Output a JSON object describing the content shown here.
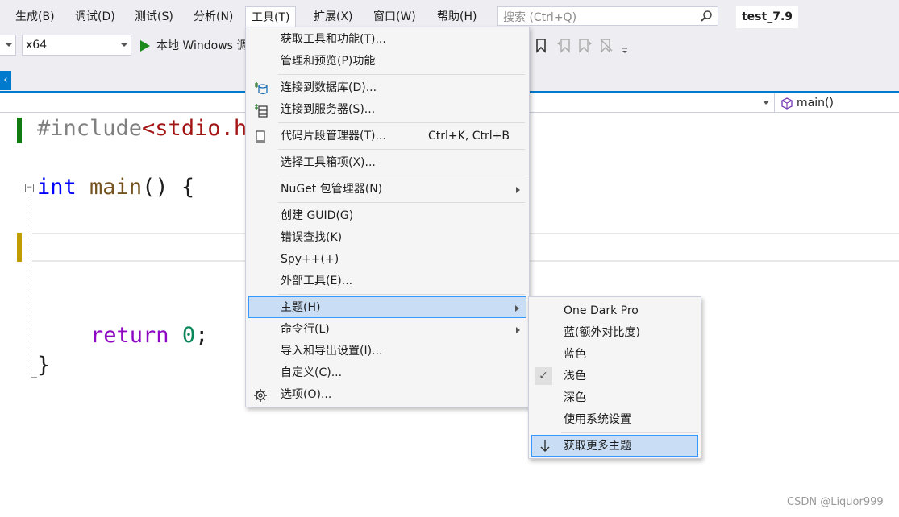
{
  "menubar": {
    "items": [
      "生成(B)",
      "调试(D)",
      "测试(S)",
      "分析(N)",
      "工具(T)",
      "扩展(X)",
      "窗口(W)",
      "帮助(H)"
    ],
    "search_placeholder": "搜索 (Ctrl+Q)",
    "project_title": "test_7.9"
  },
  "toolbar": {
    "platform": "x64",
    "run_label": "本地 Windows 调"
  },
  "navbar": {
    "function": "main()"
  },
  "editor": {
    "line_include_directive": "#include",
    "line_include_header": "<stdio.h",
    "line_main_type": "int",
    "line_main_name": "main",
    "line_main_rest": "() {",
    "line_return_kw": "return",
    "line_return_value": "0",
    "line_return_semicolon": ";",
    "line_close": "}"
  },
  "tools_menu": {
    "items": [
      {
        "label": "获取工具和功能(T)...",
        "icon": "none"
      },
      {
        "label": "管理和预览(P)功能",
        "icon": "none"
      },
      {
        "label": "连接到数据库(D)...",
        "icon": "database-connect-icon"
      },
      {
        "label": "连接到服务器(S)...",
        "icon": "server-connect-icon"
      },
      {
        "label": "代码片段管理器(T)...",
        "shortcut": "Ctrl+K, Ctrl+B",
        "icon": "snippet-icon"
      },
      {
        "label": "选择工具箱项(X)...",
        "icon": "none"
      },
      {
        "label": "NuGet 包管理器(N)",
        "submenu": true,
        "icon": "none"
      },
      {
        "label": "创建 GUID(G)",
        "icon": "none"
      },
      {
        "label": "错误查找(K)",
        "icon": "none"
      },
      {
        "label": "Spy++(+)",
        "icon": "none"
      },
      {
        "label": "外部工具(E)...",
        "icon": "none"
      },
      {
        "label": "主题(H)",
        "submenu": true,
        "highlighted": true,
        "icon": "none"
      },
      {
        "label": "命令行(L)",
        "submenu": true,
        "icon": "none"
      },
      {
        "label": "导入和导出设置(I)...",
        "icon": "none"
      },
      {
        "label": "自定义(C)...",
        "icon": "none"
      },
      {
        "label": "选项(O)...",
        "icon": "gear-icon"
      }
    ]
  },
  "theme_submenu": {
    "items": [
      {
        "label": "One Dark Pro"
      },
      {
        "label": "蓝(额外对比度)"
      },
      {
        "label": "蓝色"
      },
      {
        "label": "浅色",
        "checked": true
      },
      {
        "label": "深色"
      },
      {
        "label": "使用系统设置"
      },
      {
        "label": "获取更多主题",
        "highlighted": true,
        "icon": "arrow-down-icon"
      }
    ],
    "check_glyph": "✓"
  },
  "watermark": "CSDN @Liquor999",
  "colors": {
    "accent": "#007acc",
    "menu_highlight": "#c9def5",
    "menu_highlight_border": "#3399ff",
    "keyword": "#0000ff",
    "control_keyword": "#8f08c4",
    "include": "#808080",
    "string": "#a31515"
  }
}
